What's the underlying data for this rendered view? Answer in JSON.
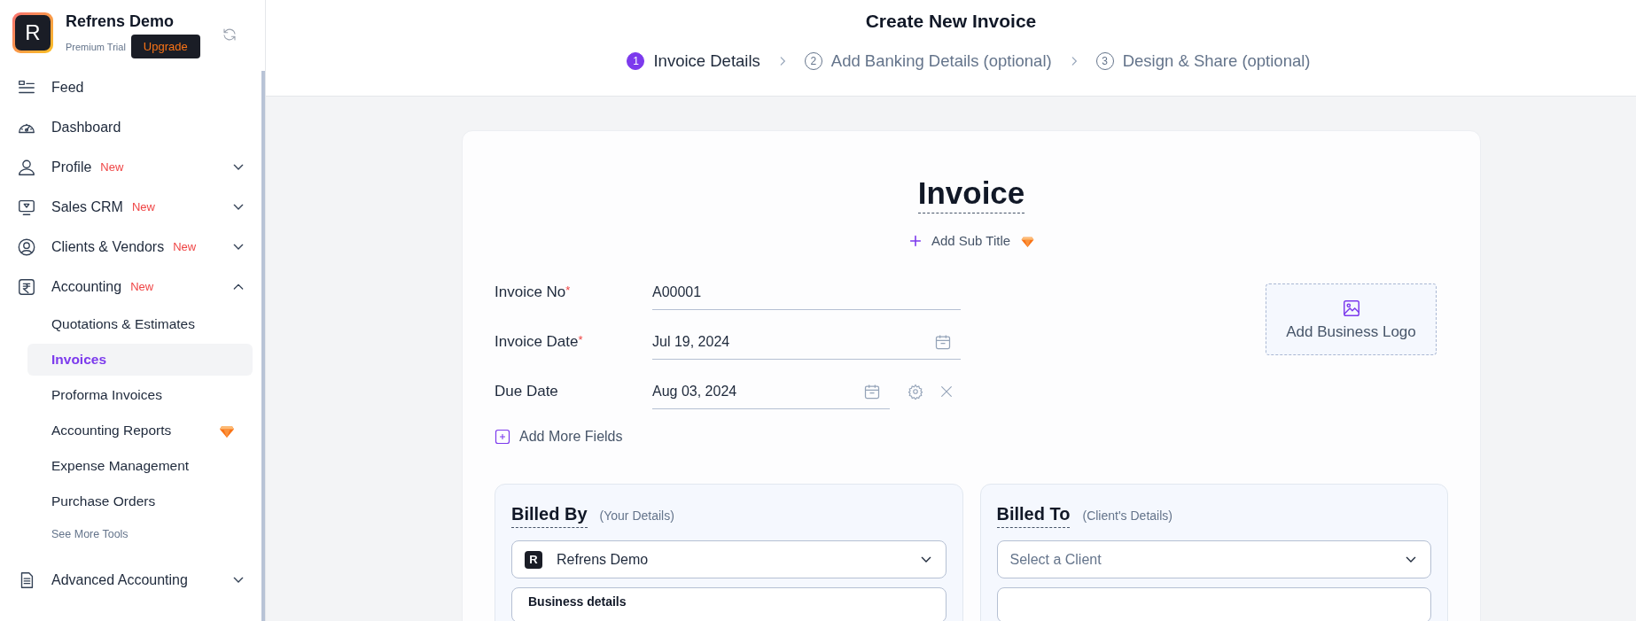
{
  "workspace": {
    "avatar": "R",
    "name": "Refrens Demo",
    "plan": "Premium Trial",
    "upgrade_button": "Upgrade"
  },
  "sidebar": {
    "items": [
      {
        "label": "Feed"
      },
      {
        "label": "Dashboard"
      },
      {
        "label": "Profile",
        "badge": "New",
        "expanded": false
      },
      {
        "label": "Sales CRM",
        "badge": "New",
        "expanded": false
      },
      {
        "label": "Clients & Vendors",
        "badge": "New",
        "expanded": false
      },
      {
        "label": "Accounting",
        "badge": "New",
        "expanded": true,
        "children": [
          {
            "label": "Quotations & Estimates",
            "selected": false,
            "premium": false
          },
          {
            "label": "Invoices",
            "selected": true,
            "premium": false
          },
          {
            "label": "Proforma Invoices",
            "selected": false,
            "premium": false
          },
          {
            "label": "Accounting Reports",
            "selected": false,
            "premium": true
          },
          {
            "label": "Expense Management",
            "selected": false,
            "premium": false
          },
          {
            "label": "Purchase Orders",
            "selected": false,
            "premium": false
          }
        ],
        "more_link": "See More Tools"
      },
      {
        "label": "Advanced Accounting",
        "expanded": false
      }
    ]
  },
  "page_title": "Create New Invoice",
  "steps": [
    {
      "number": "1",
      "label": "Invoice Details",
      "selected": true
    },
    {
      "number": "2",
      "label": "Add Banking Details (optional)",
      "selected": false
    },
    {
      "number": "3",
      "label": "Design & Share (optional)",
      "selected": false
    }
  ],
  "invoice": {
    "title": "Invoice",
    "add_subtitle": "Add Sub Title",
    "fields": [
      {
        "label": "Invoice No",
        "required_mark": "*",
        "value": "A00001",
        "kind": "text"
      },
      {
        "label": "Invoice Date",
        "required_mark": "*",
        "value": "Jul 19, 2024",
        "kind": "date"
      },
      {
        "label": "Due Date",
        "value": "Aug 03, 2024",
        "kind": "removable-date"
      }
    ],
    "add_more_fields": "Add More Fields",
    "logo_button": "Add Business Logo",
    "billed_by": {
      "title": "Billed By",
      "subtitle": "(Your Details)",
      "business": {
        "avatar": "R",
        "name": "Refrens Demo"
      },
      "section_title": "Business details"
    },
    "billed_to": {
      "title": "Billed To",
      "subtitle": "(Client's Details)",
      "placeholder": "Select a Client"
    }
  }
}
